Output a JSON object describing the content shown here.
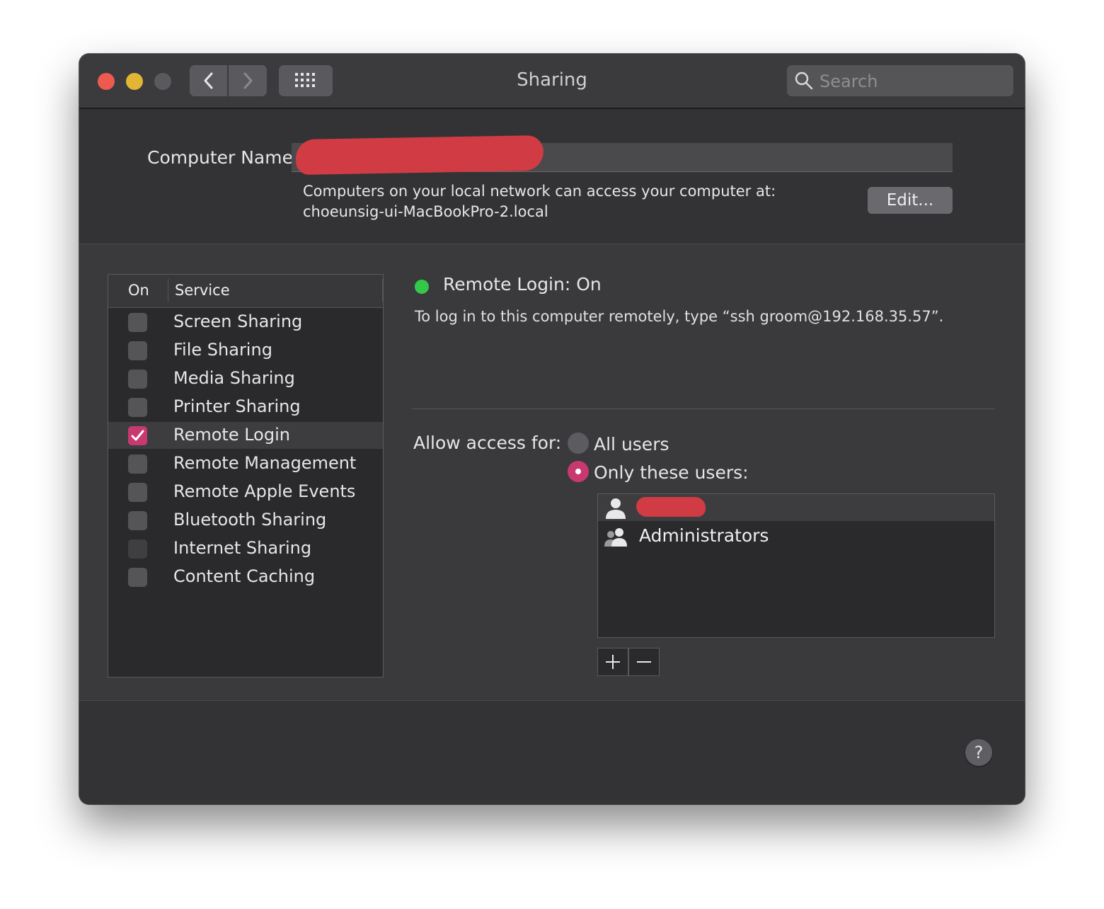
{
  "window": {
    "title": "Sharing"
  },
  "search": {
    "placeholder": "Search"
  },
  "computer_name": {
    "label": "Computer Name:",
    "value": ""
  },
  "network_access": {
    "line1": "Computers on your local network can access your computer at:",
    "line2": "choeunsig-ui-MacBookPro-2.local"
  },
  "edit_label": "Edit...",
  "services": {
    "header_on": "On",
    "header_service": "Service",
    "items": [
      {
        "name": "Screen Sharing",
        "checked": false
      },
      {
        "name": "File Sharing",
        "checked": false
      },
      {
        "name": "Media Sharing",
        "checked": false
      },
      {
        "name": "Printer Sharing",
        "checked": false
      },
      {
        "name": "Remote Login",
        "checked": true
      },
      {
        "name": "Remote Management",
        "checked": false
      },
      {
        "name": "Remote Apple Events",
        "checked": false
      },
      {
        "name": "Bluetooth Sharing",
        "checked": false
      },
      {
        "name": "Internet Sharing",
        "checked": false
      },
      {
        "name": "Content Caching",
        "checked": false
      }
    ]
  },
  "status": {
    "title": "Remote Login: On",
    "description": "To log in to this computer remotely, type “ssh groom@192.168.35.57”.",
    "color": "#34c84a"
  },
  "access": {
    "label": "Allow access for:",
    "options": [
      {
        "label": "All users",
        "selected": false
      },
      {
        "label": "Only these users:",
        "selected": true
      }
    ],
    "users": [
      {
        "name": "",
        "icon": "user-icon"
      },
      {
        "name": "Administrators",
        "icon": "group-icon"
      }
    ]
  },
  "buttons": {
    "add": "+",
    "remove": "−",
    "help": "?"
  },
  "colors": {
    "accent": "#c8396f",
    "close": "#ef5a50",
    "minimize": "#e2b634",
    "status_on": "#34c84a"
  }
}
